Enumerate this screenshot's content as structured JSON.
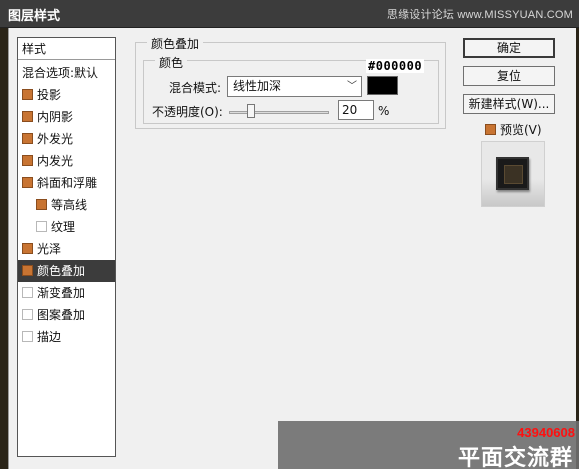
{
  "window": {
    "title": "图层样式",
    "watermark": "思缘设计论坛 www.MISSYUAN.COM"
  },
  "sidebar": {
    "header": "样式",
    "blend_options": "混合选项:默认",
    "items": [
      {
        "label": "投影",
        "checked": true
      },
      {
        "label": "内阴影",
        "checked": true
      },
      {
        "label": "外发光",
        "checked": true
      },
      {
        "label": "内发光",
        "checked": true
      },
      {
        "label": "斜面和浮雕",
        "checked": true
      },
      {
        "label": "等高线",
        "checked": true
      },
      {
        "label": "纹理",
        "checked": false
      },
      {
        "label": "光泽",
        "checked": true
      },
      {
        "label": "颜色叠加",
        "checked": true,
        "selected": true
      },
      {
        "label": "渐变叠加",
        "checked": false
      },
      {
        "label": "图案叠加",
        "checked": false
      },
      {
        "label": "描边",
        "checked": false
      }
    ]
  },
  "panel": {
    "group_title": "颜色叠加",
    "sub_group_title": "颜色",
    "blend_mode_label": "混合模式:",
    "blend_mode_value": "线性加深",
    "color_hex_label": "#000000",
    "color_value": "#000000",
    "opacity_label": "不透明度(O):",
    "opacity_value": "20",
    "opacity_unit": "%"
  },
  "buttons": {
    "ok": "确定",
    "reset": "复位",
    "new_style": "新建样式(W)...",
    "preview_label": "预览(V)"
  },
  "overlay": {
    "number": "43940608",
    "text": "平面交流群"
  },
  "colors": {
    "accent_checkbox": "#c87432",
    "selected_row": "#3c3c3c"
  }
}
